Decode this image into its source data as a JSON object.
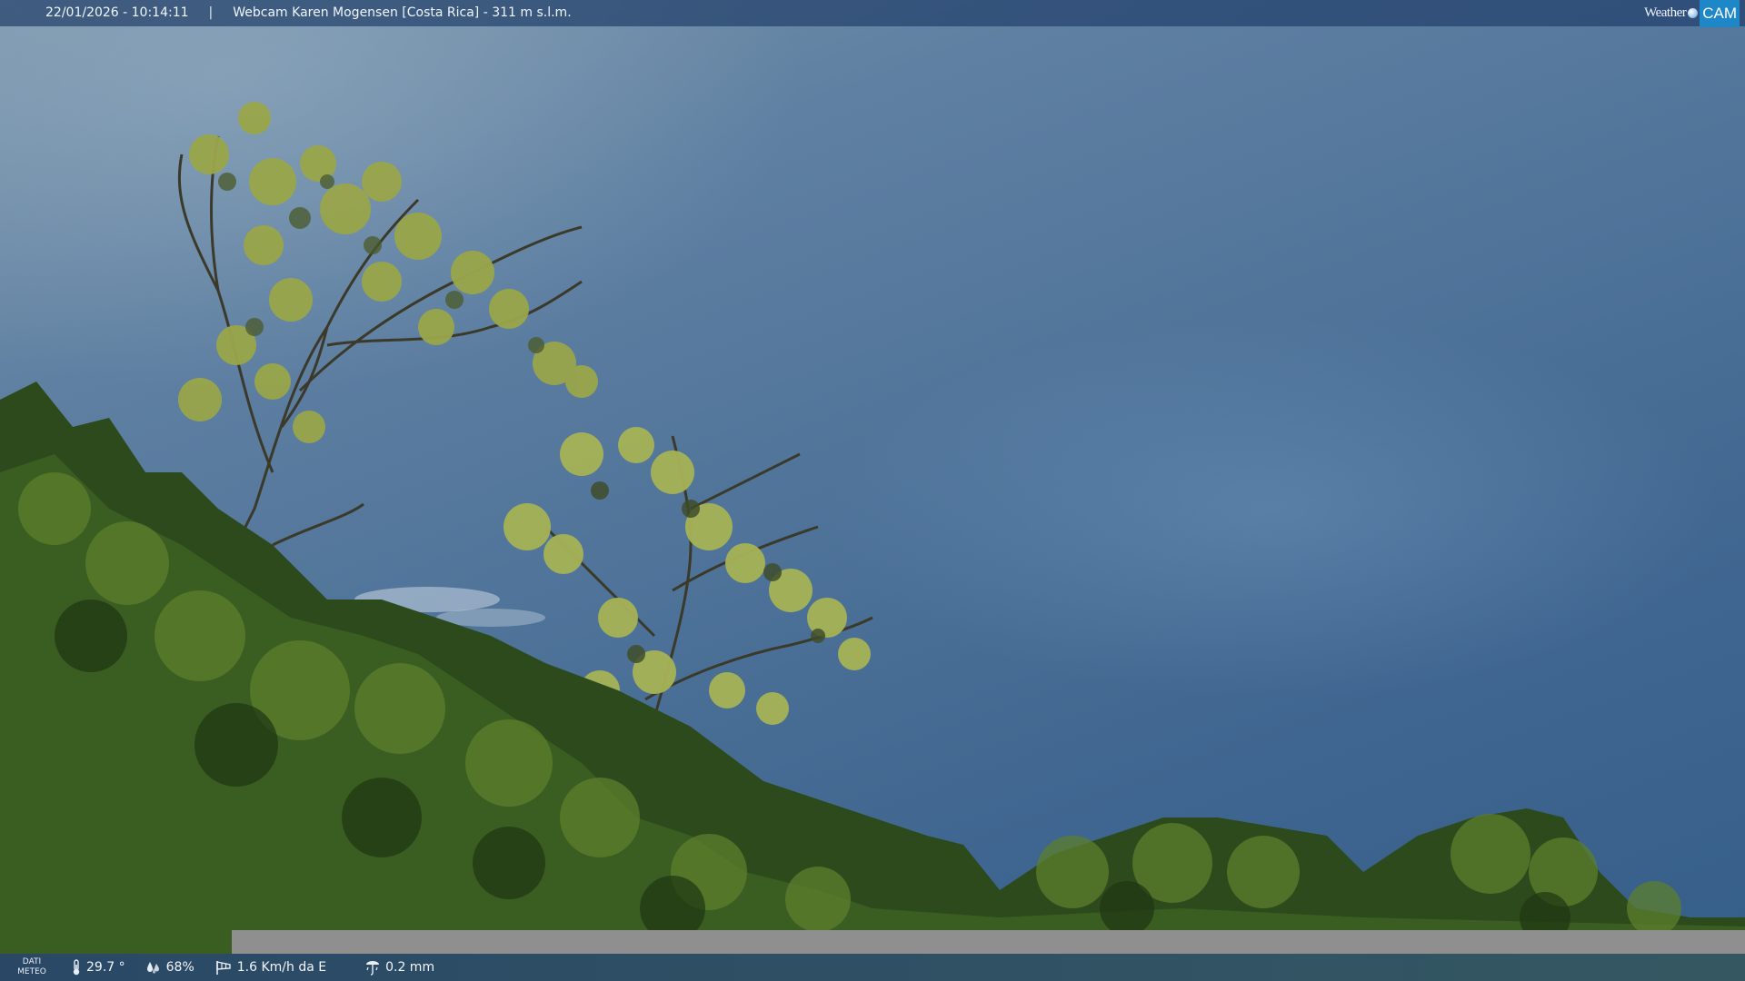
{
  "header": {
    "datetime": "22/01/2026 - 10:14:11",
    "separator": "|",
    "title": "Webcam Karen Mogensen [Costa Rica]  - 311 m s.l.m.",
    "brand_weather": "Weather",
    "brand_cam": "CAM"
  },
  "meteo": {
    "label_line1": "DATI",
    "label_line2": "METEO",
    "temperature": "29.7 °",
    "humidity": "68%",
    "wind": "1.6 Km/h da E",
    "rain": "0.2 mm"
  },
  "colors": {
    "bar_blue": "#2d4d70",
    "brand_cam_bg": "#1e87c8",
    "sky": "#4f7399",
    "foliage": "#2f4a1e"
  },
  "icons": {
    "temperature": "thermometer-icon",
    "humidity": "humidity-drops-icon",
    "wind": "wind-sock-icon",
    "rain": "rain-gauge-icon"
  }
}
